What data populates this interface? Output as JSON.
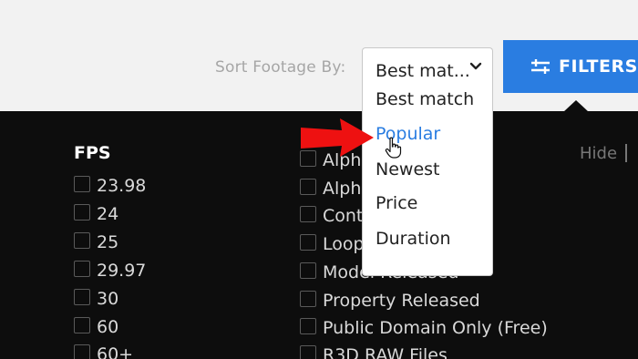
{
  "sort": {
    "label": "Sort Footage By:",
    "selected": "Best mat...",
    "options": [
      {
        "label": "Best match"
      },
      {
        "label": "Popular"
      },
      {
        "label": "Newest"
      },
      {
        "label": "Price"
      },
      {
        "label": "Duration"
      }
    ]
  },
  "filters_button": {
    "label": "FILTERS"
  },
  "filters_panel": {
    "fps": {
      "title": "FPS",
      "options": [
        "23.98",
        "24",
        "25",
        "29.97",
        "30",
        "60",
        "60+"
      ]
    },
    "other": {
      "options": [
        "Alph",
        "Alph",
        "Cont",
        "Loop",
        "Model Released",
        "Property Released",
        "Public Domain Only (Free)",
        "R3D RAW Files"
      ]
    },
    "hide_label": "Hide"
  },
  "colors": {
    "accent": "#2a7de1",
    "panel": "#0d0d0d",
    "topbar": "#f2f2f2",
    "annotation_arrow": "#ee1111"
  }
}
